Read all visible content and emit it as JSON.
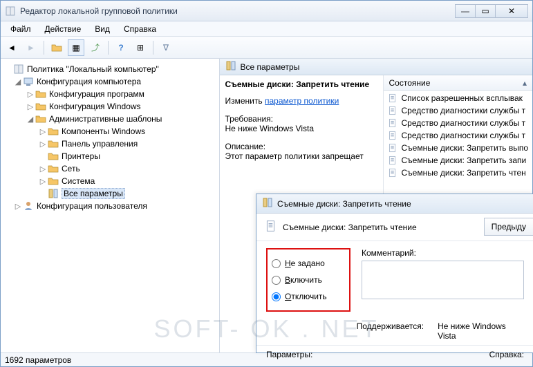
{
  "window": {
    "title": "Редактор локальной групповой политики"
  },
  "menu": {
    "file": "Файл",
    "action": "Действие",
    "view": "Вид",
    "help": "Справка"
  },
  "tree": {
    "root": "Политика \"Локальный компьютер\"",
    "comp": "Конфигурация компьютера",
    "progcfg": "Конфигурация программ",
    "wincfg": "Конфигурация Windows",
    "admtpl": "Административные шаблоны",
    "wincomp": "Компоненты Windows",
    "ctrlpanel": "Панель управления",
    "printers": "Принтеры",
    "network": "Сеть",
    "system": "Система",
    "allsettings": "Все параметры",
    "usercfg": "Конфигурация пользователя"
  },
  "right": {
    "header": "Все параметры",
    "policy_name": "Съемные диски: Запретить чтение",
    "edit_label": "Изменить",
    "edit_link": "параметр политики",
    "req_label": "Требования:",
    "req_value": "Не ниже Windows Vista",
    "desc_label": "Описание:",
    "desc_value": "Этот параметр политики запрещает",
    "col_state": "Состояние",
    "items": [
      "Список разрешенных всплывак",
      "Средство диагностики службы т",
      "Средство диагностики службы т",
      "Средство диагностики службы т",
      "Съемные диски: Запретить выпо",
      "Съемные диски: Запретить запи",
      "Съемные диски: Запретить чтен"
    ]
  },
  "dialog": {
    "title": "Съемные диски: Запретить чтение",
    "heading": "Съемные диски: Запретить чтение",
    "prev": "Предыду",
    "r_notset": "Не задано",
    "r_enable": "Включить",
    "r_disable": "Отключить",
    "comment": "Комментарий:",
    "supported": "Поддерживается:",
    "supported_val": "Не ниже Windows Vista",
    "params": "Параметры:",
    "help": "Справка:"
  },
  "status": {
    "count": "1692 параметров"
  },
  "watermark": "SOFT- OK . NET"
}
